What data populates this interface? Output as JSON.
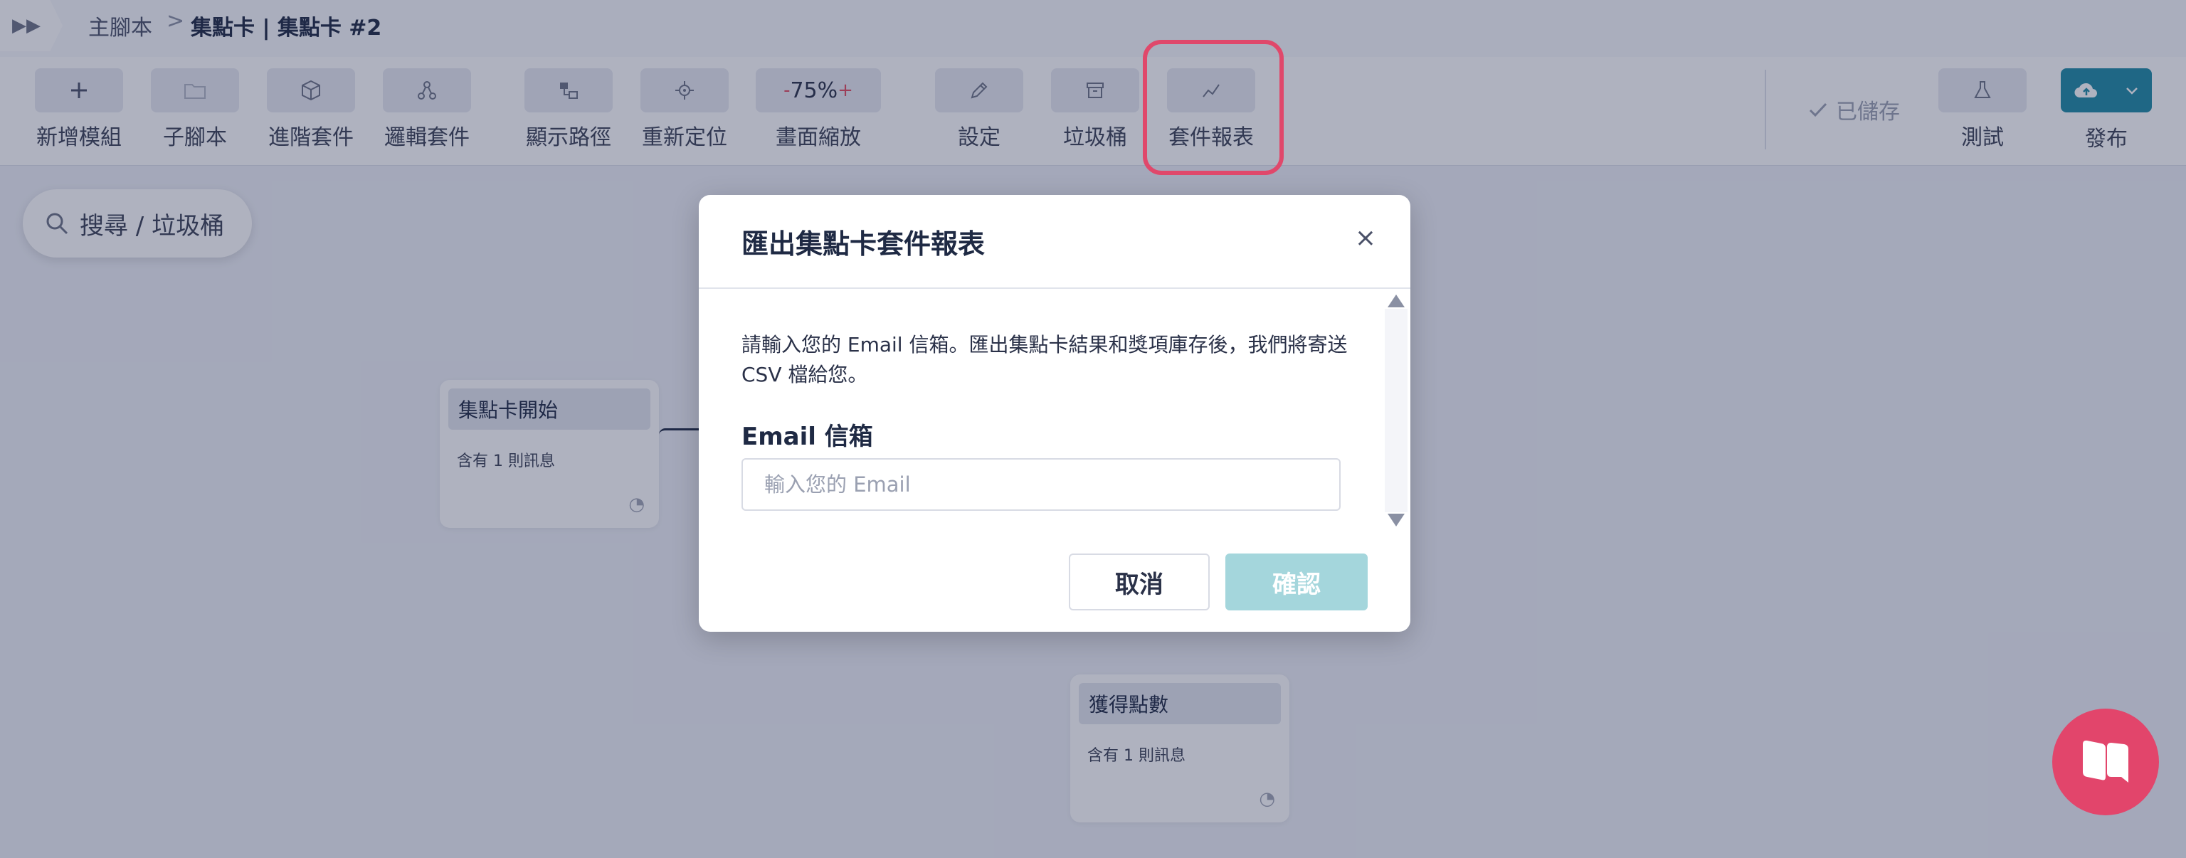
{
  "header": {
    "breadcrumb": [
      "主腳本",
      "集點卡 | 集點卡 #2"
    ],
    "separator": ">"
  },
  "toolbar": {
    "tools": [
      {
        "label": "新增模組",
        "icon": "plus-icon"
      },
      {
        "label": "子腳本",
        "icon": "folder-icon"
      },
      {
        "label": "進階套件",
        "icon": "cube-icon"
      },
      {
        "label": "邏輯套件",
        "icon": "network-icon"
      },
      {
        "label": "顯示路徑",
        "icon": "route-icon"
      },
      {
        "label": "重新定位",
        "icon": "crosshair-icon"
      },
      {
        "label": "畫面縮放",
        "icon": "zoom-control"
      },
      {
        "label": "設定",
        "icon": "pencil-icon"
      },
      {
        "label": "垃圾桶",
        "icon": "archive-icon"
      },
      {
        "label": "套件報表",
        "icon": "chart-line-icon"
      }
    ],
    "zoom": {
      "minus": "-",
      "value": "75%",
      "plus": "+"
    },
    "saved_label": "已儲存",
    "test_label": "測試",
    "publish_label": "發布"
  },
  "canvas": {
    "search_label": "搜尋 / 垃圾桶",
    "nodes": [
      {
        "title": "集點卡開始",
        "body": "含有 1 則訊息"
      },
      {
        "title": "獲得點數",
        "body": "含有 1 則訊息"
      }
    ]
  },
  "modal": {
    "title": "匯出集點卡套件報表",
    "close": "×",
    "description": "請輸入您的 Email 信箱。匯出集點卡結果和獎項庫存後，我們將寄送 CSV 檔給您。",
    "email_label": "Email 信箱",
    "email_placeholder": "輸入您的 Email",
    "email_value": "",
    "cancel": "取消",
    "confirm": "確認"
  },
  "colors": {
    "accent": "#1f8aa4",
    "highlight": "#e0486b",
    "confirm_disabled": "#a4d6dc",
    "chat_bubble": "#e2456b"
  }
}
